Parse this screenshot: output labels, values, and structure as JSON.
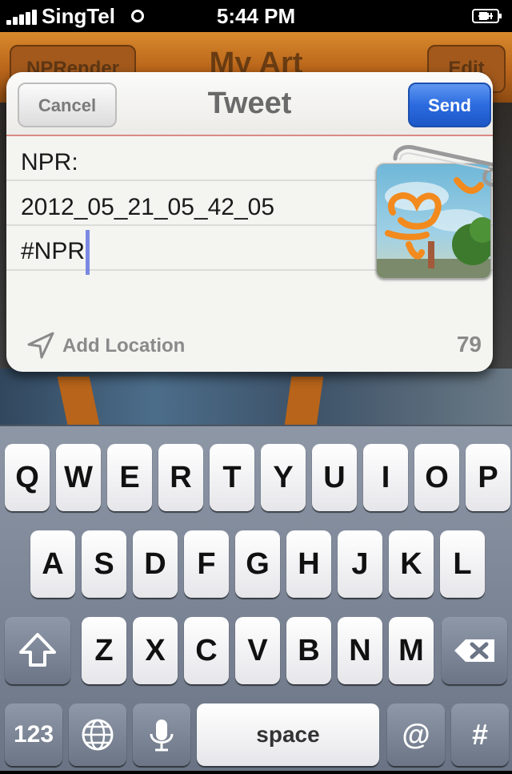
{
  "status_bar": {
    "carrier": "SingTel",
    "time": "5:44 PM"
  },
  "background_app": {
    "back_label": "NPRender",
    "title": "My Art",
    "edit_label": "Edit"
  },
  "tweet_sheet": {
    "title": "Tweet",
    "cancel_label": "Cancel",
    "send_label": "Send",
    "lines": [
      "NPR:",
      "2012_05_21_05_42_05",
      "#NPR"
    ],
    "add_location_label": "Add Location",
    "char_count": "79",
    "attachment_icon": "paperclip-icon"
  },
  "keyboard": {
    "row1": [
      "Q",
      "W",
      "E",
      "R",
      "T",
      "Y",
      "U",
      "I",
      "O",
      "P"
    ],
    "row2": [
      "A",
      "S",
      "D",
      "F",
      "G",
      "H",
      "J",
      "K",
      "L"
    ],
    "row3": [
      "Z",
      "X",
      "C",
      "V",
      "B",
      "N",
      "M"
    ],
    "numbers_label": "123",
    "space_label": "space",
    "at_label": "@",
    "hash_label": "#"
  },
  "colors": {
    "send_blue": "#2c6be0",
    "nav_orange": "#b8641a"
  }
}
